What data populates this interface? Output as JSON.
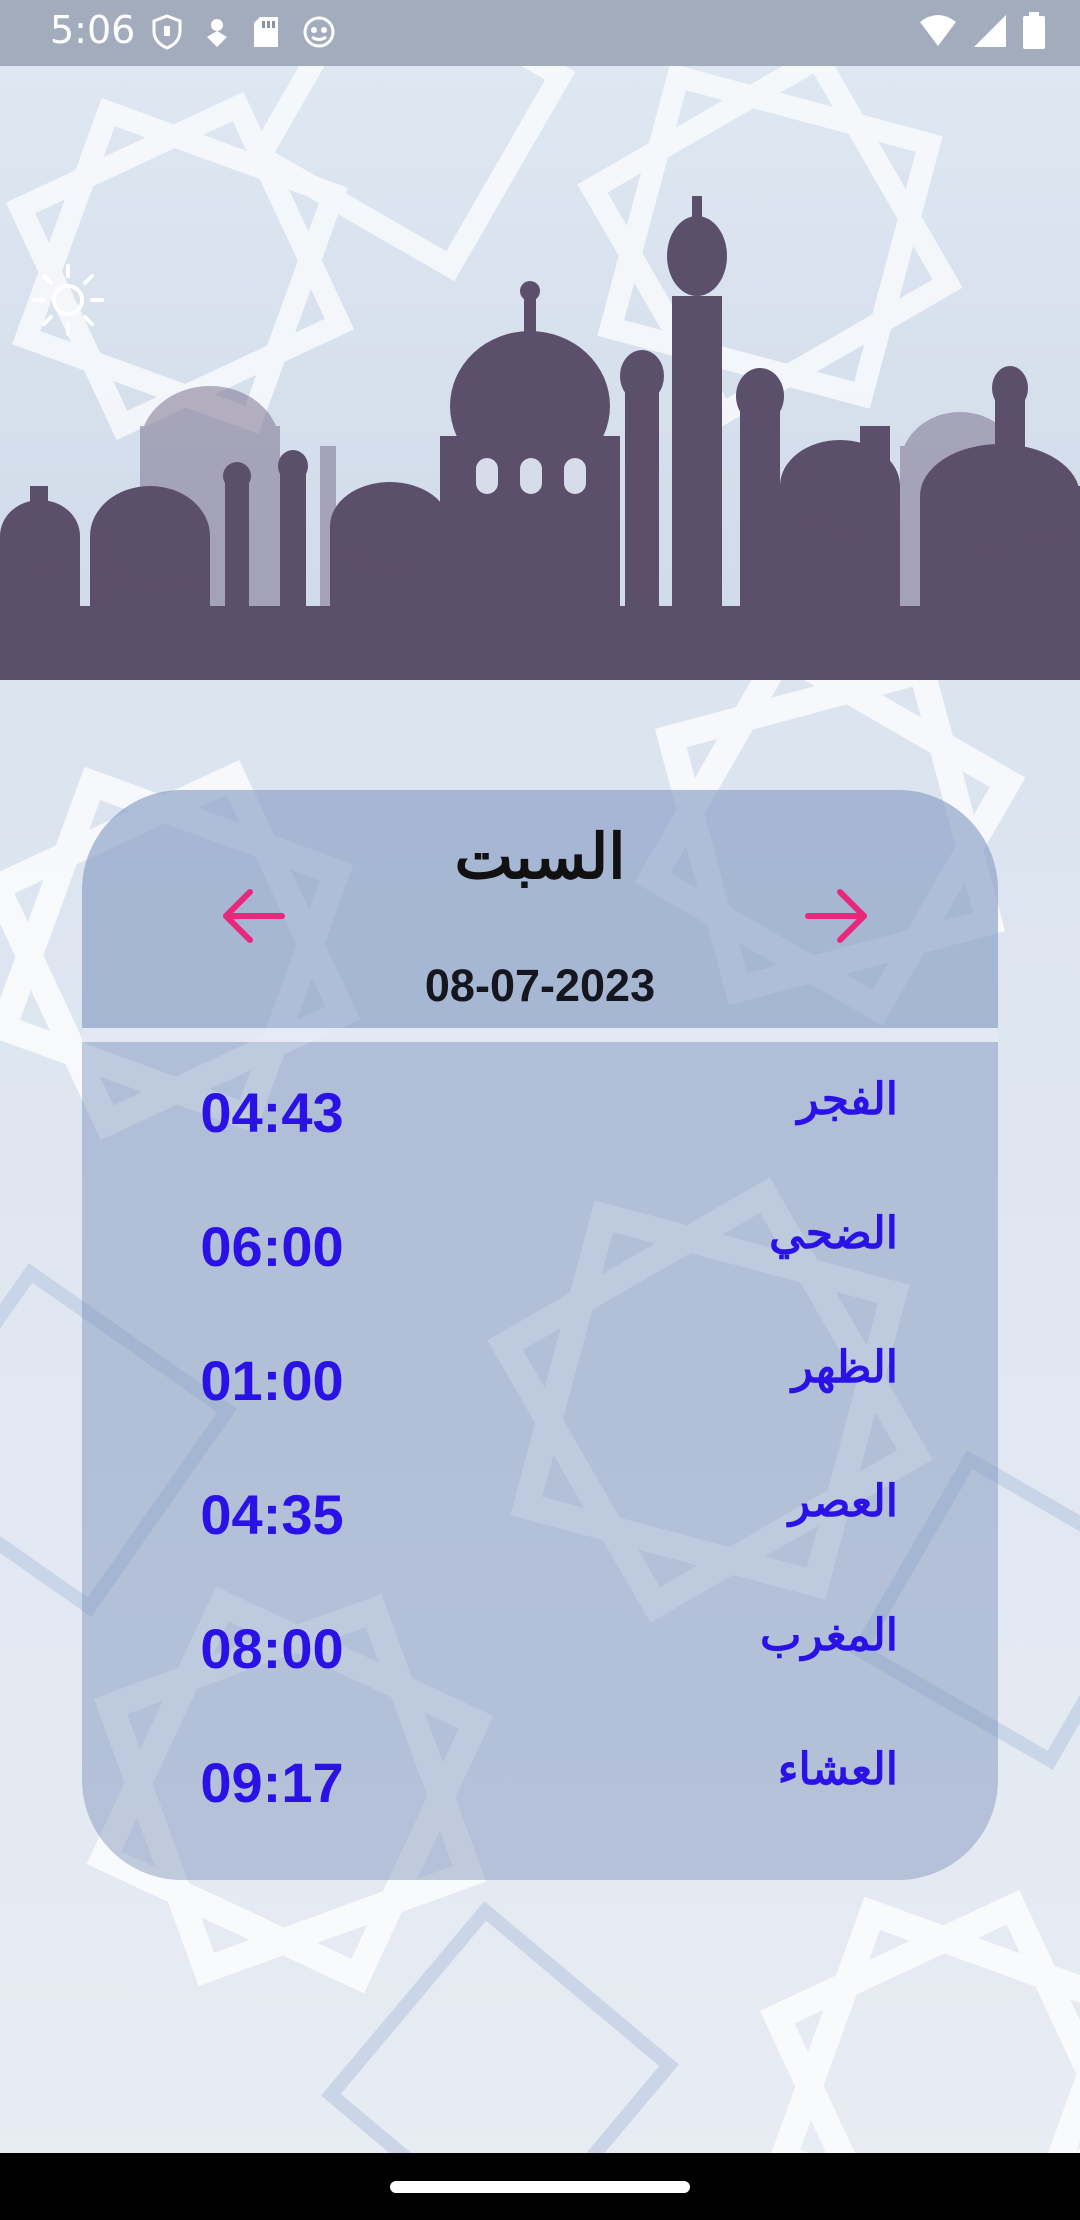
{
  "status_bar": {
    "time": "5:06",
    "left_icons": [
      "shield-icon",
      "location-icon",
      "sd-card-icon",
      "face-icon"
    ],
    "right_icons": [
      "wifi-icon",
      "signal-icon",
      "battery-icon"
    ]
  },
  "header": {
    "brightness_icon": "sun-icon",
    "illustration": "mosque-silhouette"
  },
  "day_card": {
    "day_name": "السبت",
    "date": "08-07-2023",
    "prev_icon": "arrow-left-icon",
    "next_icon": "arrow-right-icon",
    "arrow_color": "#e8287a"
  },
  "prayers": [
    {
      "name": "الفجر",
      "time": "04:43"
    },
    {
      "name": "الضحي",
      "time": "06:00"
    },
    {
      "name": "الظهر",
      "time": "01:00"
    },
    {
      "name": "العصر",
      "time": "04:35"
    },
    {
      "name": "المغرب",
      "time": "08:00"
    },
    {
      "name": "العشاء",
      "time": "09:17"
    }
  ],
  "colors": {
    "prayer_text": "#2a12e6",
    "background": "#e3e9f3",
    "silhouette": "#5c4f6b"
  }
}
